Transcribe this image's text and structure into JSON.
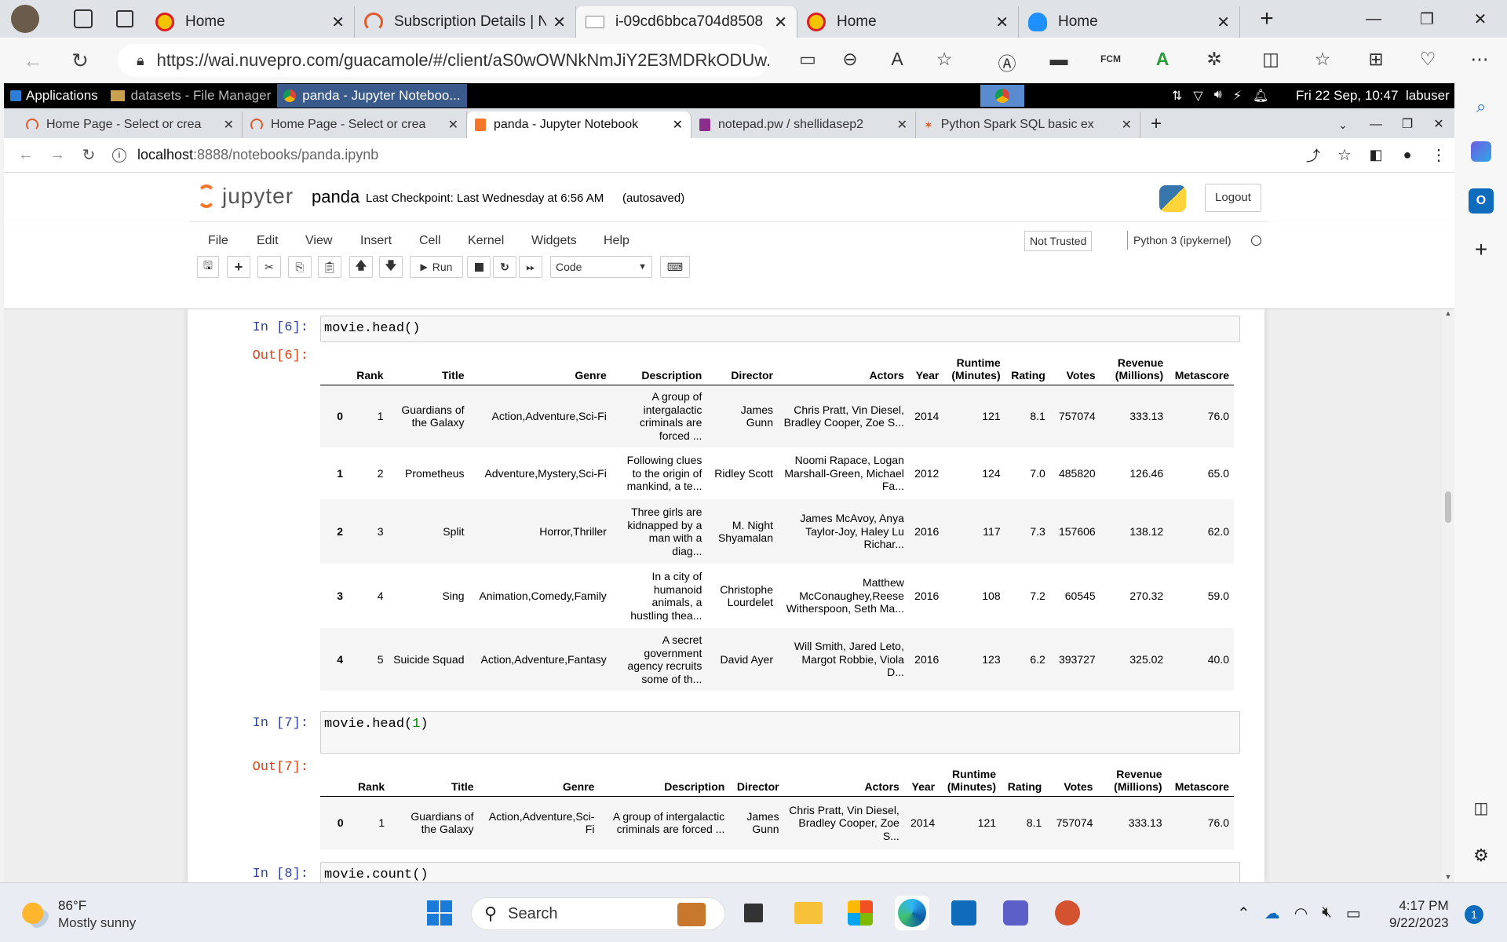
{
  "edge": {
    "tabs": [
      {
        "label": "Home",
        "icon": "shell-logo-icon",
        "active": false
      },
      {
        "label": "Subscription Details | N",
        "icon": "loading-arc-icon",
        "active": false
      },
      {
        "label": "i-09cd6bbca704d8508",
        "icon": "remote-desktop-icon",
        "active": true
      },
      {
        "label": "Home",
        "icon": "shell-logo-icon",
        "active": false
      },
      {
        "label": "Home",
        "icon": "cloud-icon",
        "active": false
      }
    ],
    "url": "https://wai.nuvepro.com/guacamole/#/client/aS0wOWNkNmJiY2E3MDRkODUw..."
  },
  "xfce": {
    "applications": "Applications",
    "windows": [
      "datasets - File Manager",
      "panda - Jupyter Noteboo..."
    ],
    "datetime": "Fri 22 Sep, 10:47",
    "user": "labuser"
  },
  "chrome": {
    "tabs": [
      {
        "label": "Home Page - Select or crea",
        "active": false
      },
      {
        "label": "Home Page - Select or crea",
        "active": false
      },
      {
        "label": "panda - Jupyter Notebook",
        "active": true
      },
      {
        "label": "notepad.pw / shellidasep2",
        "active": false
      },
      {
        "label": "Python Spark SQL basic ex",
        "active": false
      }
    ],
    "url_host": "localhost",
    "url_path": ":8888/notebooks/panda.ipynb"
  },
  "jupyter": {
    "logo": "jupyter",
    "notebook_name": "panda",
    "checkpoint": "Last Checkpoint: Last Wednesday at 6:56 AM",
    "autosaved": "(autosaved)",
    "logout": "Logout",
    "menu": [
      "File",
      "Edit",
      "View",
      "Insert",
      "Cell",
      "Kernel",
      "Widgets",
      "Help"
    ],
    "not_trusted": "Not Trusted",
    "kernel": "Python 3 (ipykernel)",
    "run_label": "Run",
    "cell_type": "Code"
  },
  "cells": {
    "c6": {
      "in_prompt": "In [6]:",
      "code": "movie.head()",
      "out_prompt": "Out[6]:"
    },
    "c7": {
      "in_prompt": "In [7]:",
      "code_prefix": "movie.head(",
      "code_num": "1",
      "code_suffix": ")",
      "out_prompt": "Out[7]:"
    },
    "c8": {
      "in_prompt": "In [8]:",
      "code": "movie.count()"
    }
  },
  "table_headers": {
    "rank": "Rank",
    "title": "Title",
    "genre": "Genre",
    "description": "Description",
    "director": "Director",
    "actors": "Actors",
    "year": "Year",
    "runtime1": "Runtime",
    "runtime2": "(Minutes)",
    "rating": "Rating",
    "votes": "Votes",
    "revenue1": "Revenue",
    "revenue2": "(Millions)",
    "metascore": "Metascore"
  },
  "table6": [
    {
      "idx": "0",
      "rank": "1",
      "title": "Guardians of the Galaxy",
      "genre": "Action,Adventure,Sci-Fi",
      "description": "A group of intergalactic criminals are forced ...",
      "director": "James Gunn",
      "actors": "Chris Pratt, Vin Diesel, Bradley Cooper, Zoe S...",
      "year": "2014",
      "runtime": "121",
      "rating": "8.1",
      "votes": "757074",
      "revenue": "333.13",
      "metascore": "76.0"
    },
    {
      "idx": "1",
      "rank": "2",
      "title": "Prometheus",
      "genre": "Adventure,Mystery,Sci-Fi",
      "description": "Following clues to the origin of mankind, a te...",
      "director": "Ridley Scott",
      "actors": "Noomi Rapace, Logan Marshall-Green, Michael Fa...",
      "year": "2012",
      "runtime": "124",
      "rating": "7.0",
      "votes": "485820",
      "revenue": "126.46",
      "metascore": "65.0"
    },
    {
      "idx": "2",
      "rank": "3",
      "title": "Split",
      "genre": "Horror,Thriller",
      "description": "Three girls are kidnapped by a man with a diag...",
      "director": "M. Night Shyamalan",
      "actors": "James McAvoy, Anya Taylor-Joy, Haley Lu Richar...",
      "year": "2016",
      "runtime": "117",
      "rating": "7.3",
      "votes": "157606",
      "revenue": "138.12",
      "metascore": "62.0"
    },
    {
      "idx": "3",
      "rank": "4",
      "title": "Sing",
      "genre": "Animation,Comedy,Family",
      "description": "In a city of humanoid animals, a hustling thea...",
      "director": "Christophe Lourdelet",
      "actors": "Matthew McConaughey,Reese Witherspoon, Seth Ma...",
      "year": "2016",
      "runtime": "108",
      "rating": "7.2",
      "votes": "60545",
      "revenue": "270.32",
      "metascore": "59.0"
    },
    {
      "idx": "4",
      "rank": "5",
      "title": "Suicide Squad",
      "genre": "Action,Adventure,Fantasy",
      "description": "A secret government agency recruits some of th...",
      "director": "David Ayer",
      "actors": "Will Smith, Jared Leto, Margot Robbie, Viola D...",
      "year": "2016",
      "runtime": "123",
      "rating": "6.2",
      "votes": "393727",
      "revenue": "325.02",
      "metascore": "40.0"
    }
  ],
  "table7": [
    {
      "idx": "0",
      "rank": "1",
      "title": "Guardians of the Galaxy",
      "genre": "Action,Adventure,Sci-Fi",
      "description": "A group of intergalactic criminals are forced ...",
      "director": "James Gunn",
      "actors": "Chris Pratt, Vin Diesel, Bradley Cooper, Zoe S...",
      "year": "2014",
      "runtime": "121",
      "rating": "8.1",
      "votes": "757074",
      "revenue": "333.13",
      "metascore": "76.0"
    }
  ],
  "taskbar": {
    "weather_temp": "86°F",
    "weather_desc": "Mostly sunny",
    "search": "Search",
    "time": "4:17 PM",
    "date": "9/22/2023",
    "notif_count": "1"
  }
}
